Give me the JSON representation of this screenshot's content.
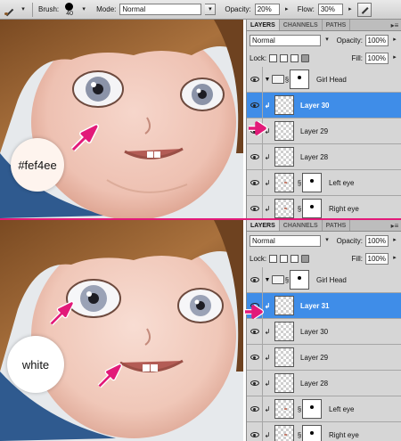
{
  "options_bar": {
    "brush_label": "Brush:",
    "brush_size": "40",
    "mode_label": "Mode:",
    "mode_value": "Normal",
    "opacity_label": "Opacity:",
    "opacity_value": "20%",
    "flow_label": "Flow:",
    "flow_value": "30%",
    "icons": [
      "brush-tool-icon",
      "airbrush-icon"
    ]
  },
  "colors": {
    "accent_pink": "#e21a79",
    "selected_layer": "#3f8de8",
    "swatch_top": "#fef4ee",
    "swatch_bottom": "#ffffff"
  },
  "steps": [
    {
      "badge": "#fef4ee",
      "panel": {
        "tabs": [
          "LAYERS",
          "CHANNELS",
          "PATHS"
        ],
        "blend_mode": "Normal",
        "opacity_label": "Opacity:",
        "opacity_value": "100%",
        "lock_label": "Lock:",
        "fill_label": "Fill:",
        "fill_value": "100%",
        "layers": [
          {
            "name": "Girl Head",
            "type": "group"
          },
          {
            "name": "Layer 30",
            "type": "layer",
            "selected": true
          },
          {
            "name": "Layer 29",
            "type": "layer"
          },
          {
            "name": "Layer 28",
            "type": "layer"
          },
          {
            "name": "Left eye",
            "type": "masked"
          },
          {
            "name": "Right eye",
            "type": "masked"
          }
        ]
      }
    },
    {
      "badge": "white",
      "panel": {
        "tabs": [
          "LAYERS",
          "CHANNELS",
          "PATHS"
        ],
        "blend_mode": "Normal",
        "opacity_label": "Opacity:",
        "opacity_value": "100%",
        "lock_label": "Lock:",
        "fill_label": "Fill:",
        "fill_value": "100%",
        "layers": [
          {
            "name": "Girl Head",
            "type": "group"
          },
          {
            "name": "Layer 31",
            "type": "layer",
            "selected": true
          },
          {
            "name": "Layer 30",
            "type": "layer"
          },
          {
            "name": "Layer 29",
            "type": "layer"
          },
          {
            "name": "Layer 28",
            "type": "layer"
          },
          {
            "name": "Left eye",
            "type": "masked"
          },
          {
            "name": "Right eye",
            "type": "masked"
          }
        ]
      }
    }
  ]
}
